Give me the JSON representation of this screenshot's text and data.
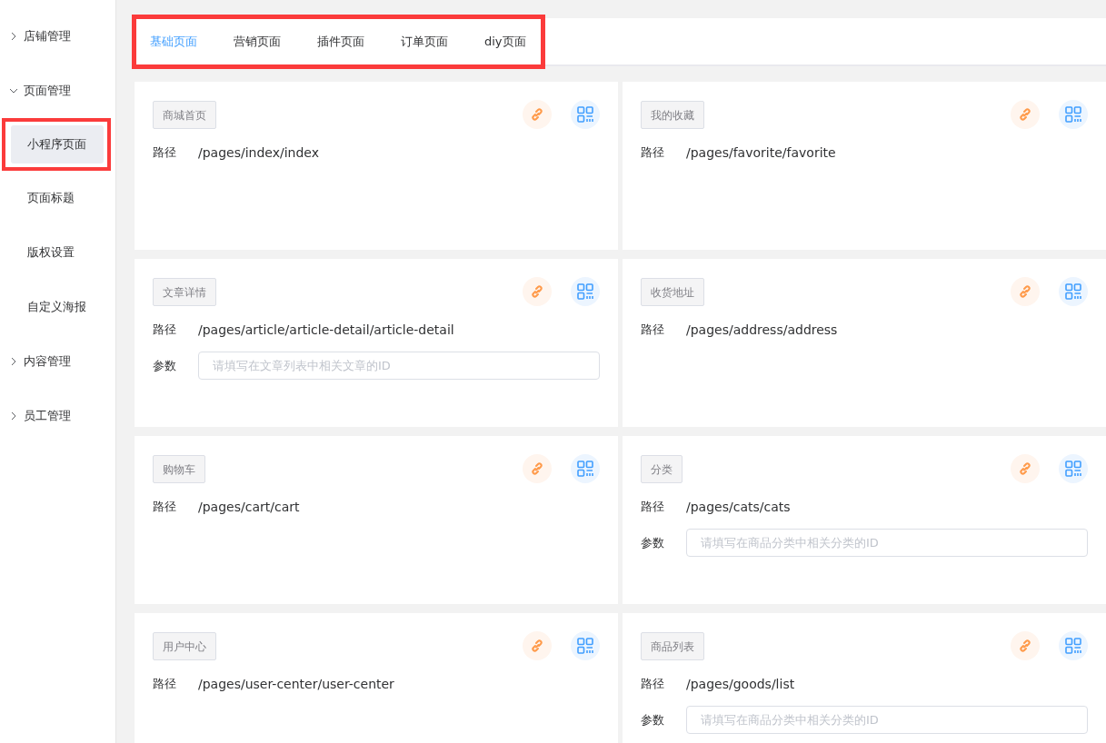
{
  "sidebar": {
    "items": [
      {
        "label": "店铺管理",
        "expanded": false
      },
      {
        "label": "页面管理",
        "expanded": true,
        "children": [
          {
            "label": "小程序页面",
            "selected": true,
            "highlighted": true
          },
          {
            "label": "页面标题",
            "selected": false,
            "highlighted": false
          },
          {
            "label": "版权设置",
            "selected": false,
            "highlighted": false
          },
          {
            "label": "自定义海报",
            "selected": false,
            "highlighted": false
          }
        ]
      },
      {
        "label": "内容管理",
        "expanded": false
      },
      {
        "label": "员工管理",
        "expanded": false
      }
    ]
  },
  "tabs": {
    "highlighted": true,
    "items": [
      {
        "label": "基础页面",
        "selected": true
      },
      {
        "label": "营销页面",
        "selected": false
      },
      {
        "label": "插件页面",
        "selected": false
      },
      {
        "label": "订单页面",
        "selected": false
      },
      {
        "label": "diy页面",
        "selected": false
      }
    ]
  },
  "pages": [
    {
      "tag": "商城首页",
      "path_label": "路径",
      "path": "/pages/index/index"
    },
    {
      "tag": "我的收藏",
      "path_label": "路径",
      "path": "/pages/favorite/favorite"
    },
    {
      "tag": "文章详情",
      "path_label": "路径",
      "path": "/pages/article/article-detail/article-detail",
      "param_label": "参数",
      "placeholder": "请填写在文章列表中相关文章的ID"
    },
    {
      "tag": "收货地址",
      "path_label": "路径",
      "path": "/pages/address/address"
    },
    {
      "tag": "购物车",
      "path_label": "路径",
      "path": "/pages/cart/cart"
    },
    {
      "tag": "分类",
      "path_label": "路径",
      "path": "/pages/cats/cats",
      "param_label": "参数",
      "placeholder": "请填写在商品分类中相关分类的ID"
    },
    {
      "tag": "用户中心",
      "path_label": "路径",
      "path": "/pages/user-center/user-center"
    },
    {
      "tag": "商品列表",
      "path_label": "路径",
      "path": "/pages/goods/list",
      "param_label": "参数",
      "placeholder": "请填写在商品分类中相关分类的ID"
    }
  ]
}
